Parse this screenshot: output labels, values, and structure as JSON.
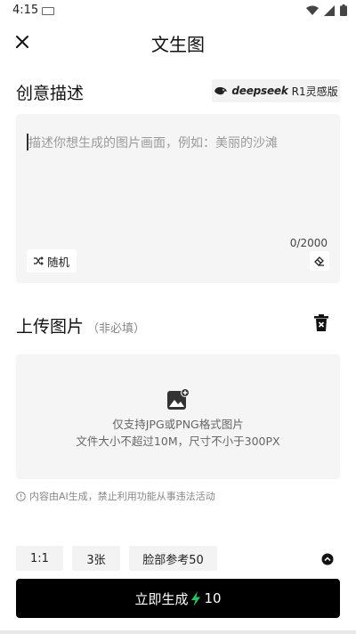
{
  "status_bar": {
    "time": "4:15"
  },
  "header": {
    "title": "文生图"
  },
  "creative": {
    "title": "创意描述",
    "badge_brand": "deepseek",
    "badge_version": "R1灵感版",
    "placeholder": "描述你想生成的图片画面，例如：美丽的沙滩",
    "char_count": "0/2000",
    "random_label": "随机"
  },
  "upload": {
    "title": "上传图片",
    "optional_label": "（非必填）",
    "line1": "仅支持JPG或PNG格式图片",
    "line2": "文件大小不超过10M，尺寸不小于300PX"
  },
  "notice": "内容由AI生成，禁止利用功能从事违法活动",
  "options": {
    "ratio": "1:1",
    "count": "3张",
    "face_ref": "脸部参考50"
  },
  "generate": {
    "label": "立即生成",
    "cost": "10"
  },
  "colors": {
    "accent_bolt": "#22c55e",
    "button_bg": "#000000"
  }
}
